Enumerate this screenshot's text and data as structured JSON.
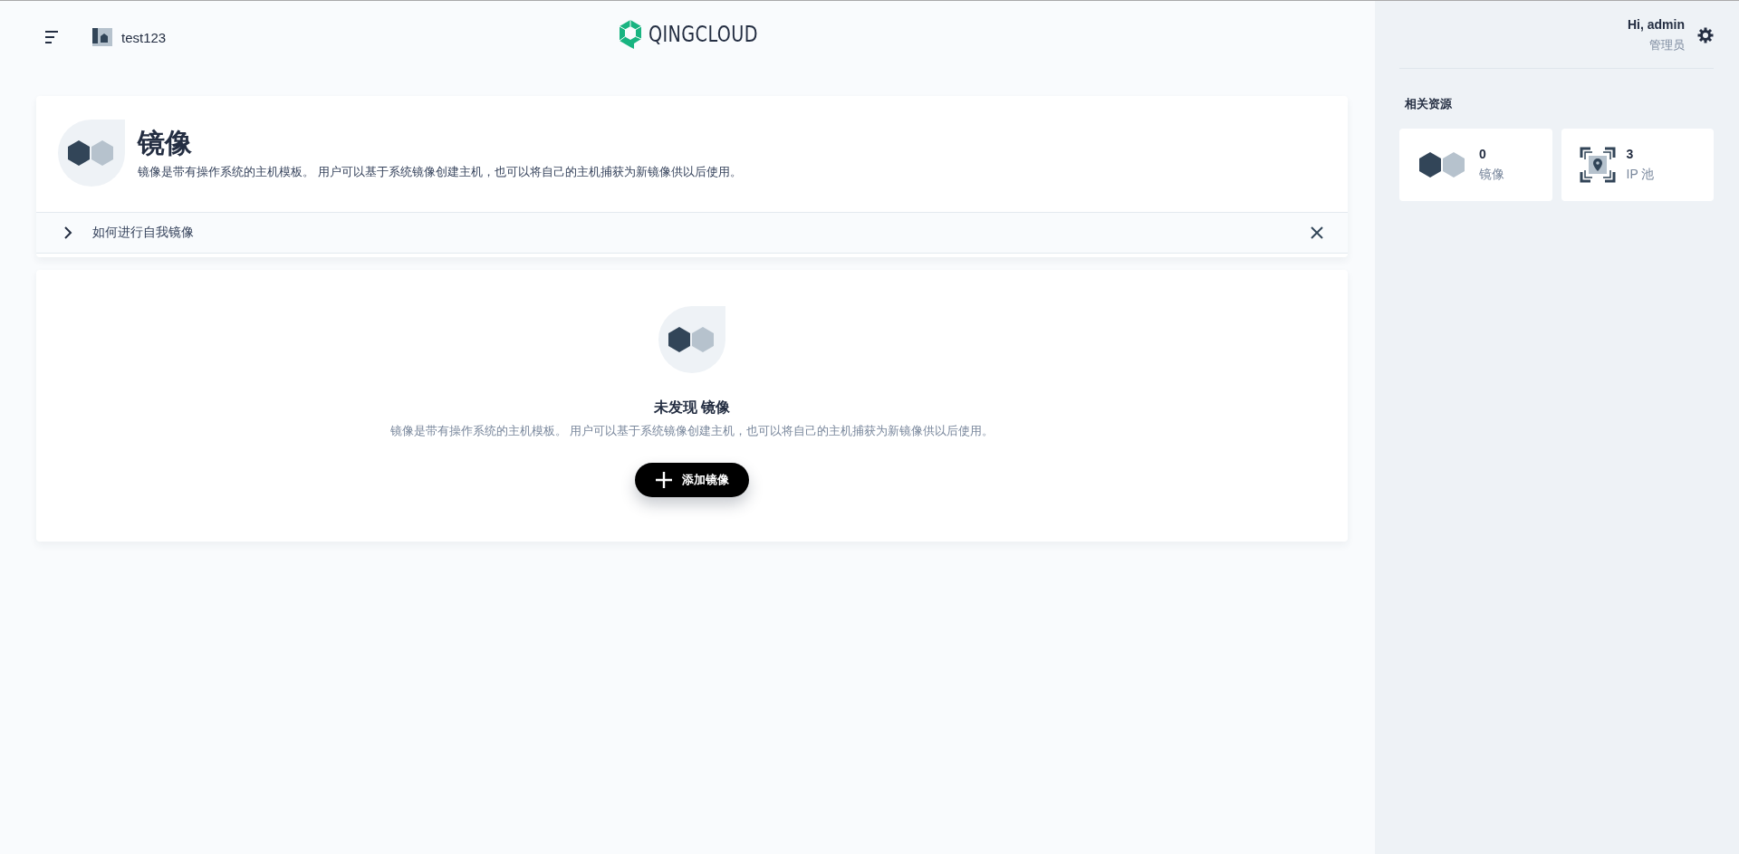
{
  "header": {
    "workspace": "test123",
    "logo_text": "QINGCLOUD"
  },
  "page": {
    "title": "镜像",
    "description": "镜像是带有操作系统的主机模板。 用户可以基于系统镜像创建主机，也可以将自己的主机捕获为新镜像供以后使用。",
    "guide": {
      "label": "如何进行自我镜像",
      "expanded": false
    }
  },
  "empty_state": {
    "title": "未发现 镜像",
    "description": "镜像是带有操作系统的主机模板。 用户可以基于系统镜像创建主机，也可以将自己的主机捕获为新镜像供以后使用。",
    "button": "添加镜像"
  },
  "user": {
    "greeting": "Hi, admin",
    "role": "管理员"
  },
  "related": {
    "title": "相关资源",
    "items": [
      {
        "kind": "image",
        "count": "0",
        "label": "镜像"
      },
      {
        "kind": "ippool",
        "count": "3",
        "label": "IP 池"
      }
    ]
  }
}
